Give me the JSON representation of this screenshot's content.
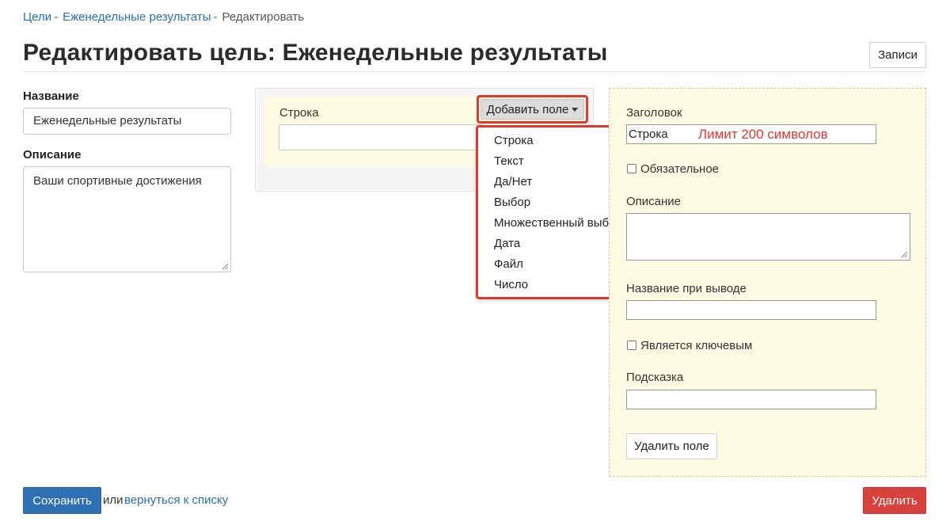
{
  "breadcrumb": {
    "items": [
      "Цели",
      "Еженедельные результаты",
      "Редактировать"
    ],
    "separator": "-"
  },
  "page_title": "Редактировать цель: Еженедельные результаты",
  "header": {
    "records_button": "Записи"
  },
  "form": {
    "name_label": "Название",
    "name_value": "Еженедельные результаты",
    "description_label": "Описание",
    "description_value": "Ваши спортивные достижения"
  },
  "fields_list": {
    "row_label": "Строка",
    "add_field_button": "Добавить поле",
    "dropdown_items": [
      "Строка",
      "Текст",
      "Да/Нет",
      "Выбор",
      "Множественный выбор",
      "Дата",
      "Файл",
      "Число"
    ]
  },
  "field_settings": {
    "title_label": "Заголовок",
    "title_value": "Строка",
    "limit_note": "Лимит 200 символов",
    "required_label": "Обязательное",
    "description_label": "Описание",
    "output_name_label": "Название при выводе",
    "is_key_label": "Является ключевым",
    "hint_label": "Подсказка",
    "delete_field_button": "Удалить поле"
  },
  "footer": {
    "save_button": "Сохранить",
    "or_text": "или",
    "back_link": "вернуться к списку",
    "delete_button": "Удалить"
  },
  "colors": {
    "primary": "#2f6fb3",
    "danger": "#d9413c",
    "highlight": "#e03a2f",
    "panel_yellow": "#fdfde3"
  }
}
